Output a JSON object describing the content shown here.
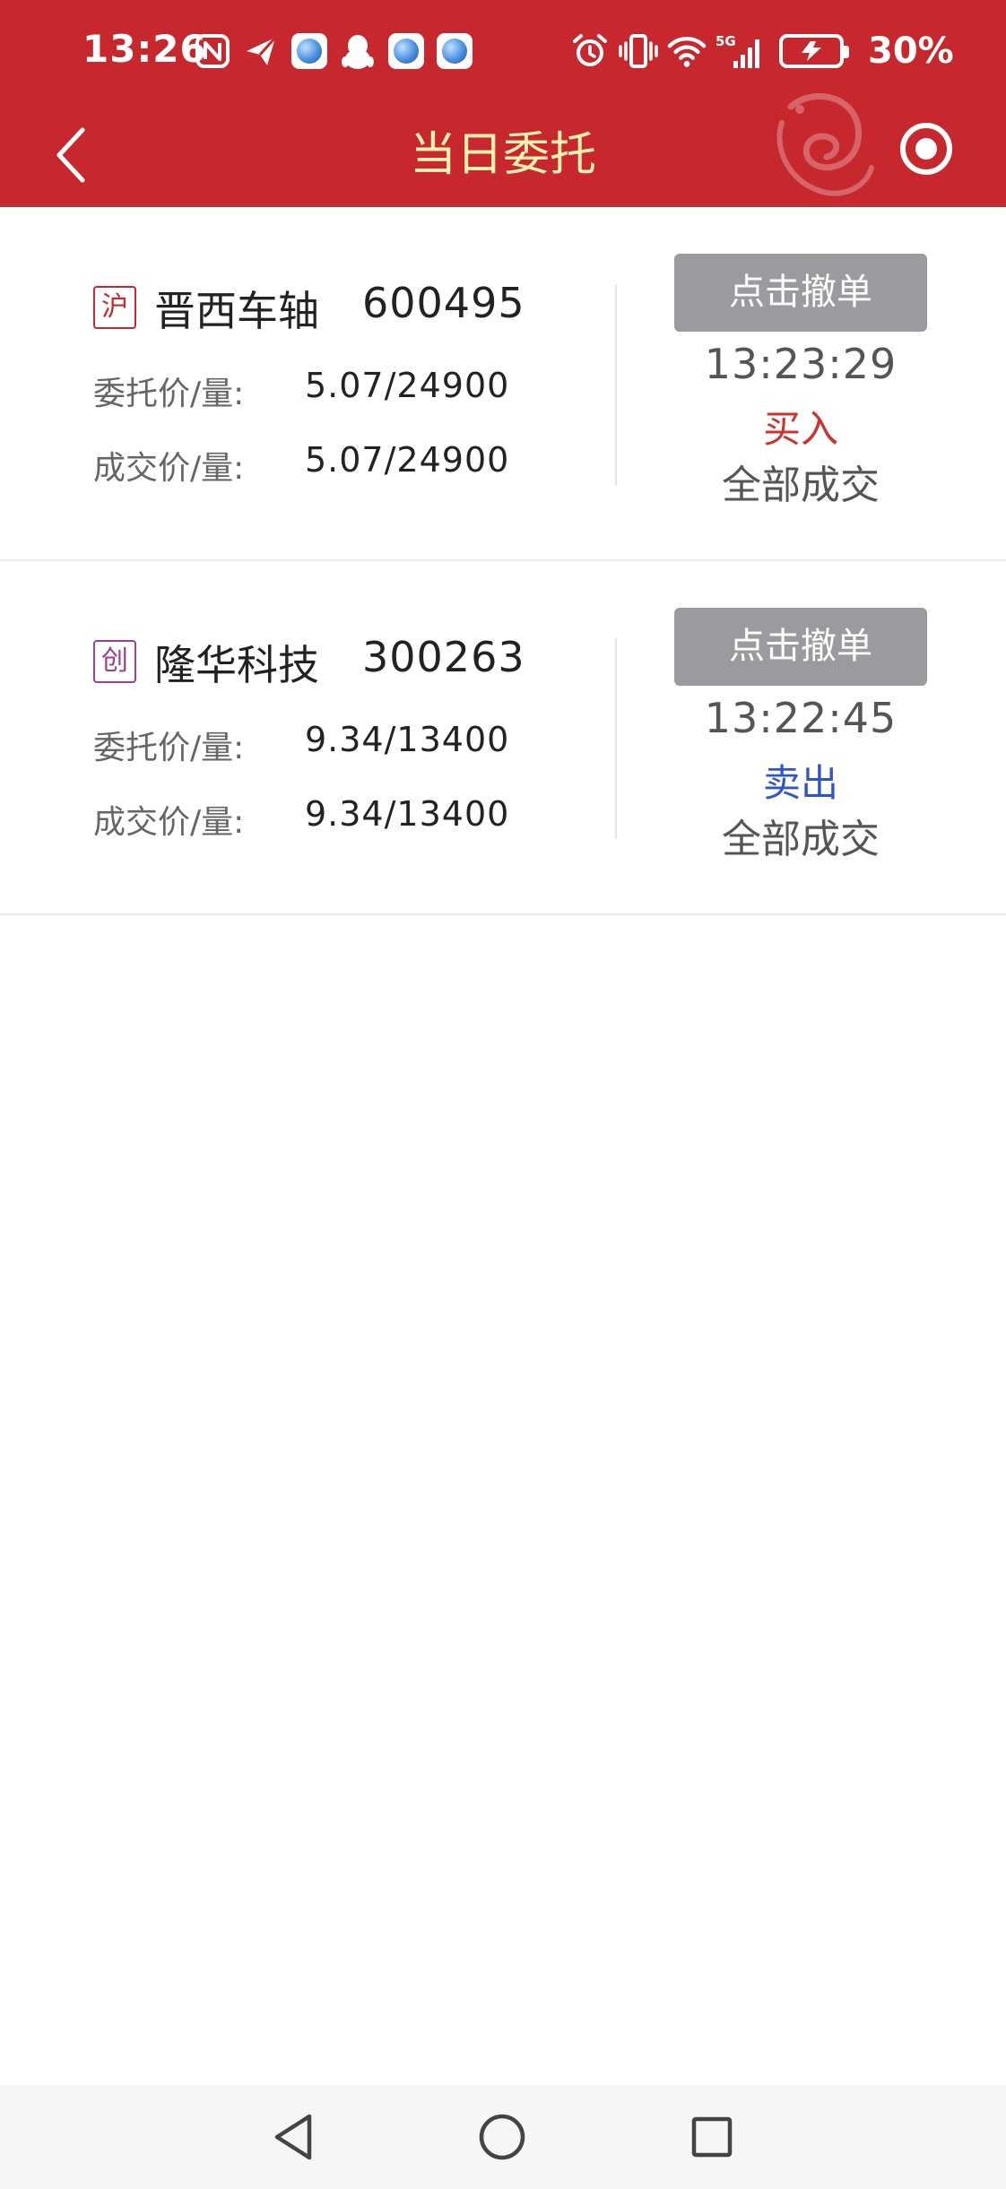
{
  "status_bar": {
    "time": "13:26",
    "battery_percent": "30%",
    "left_icons": [
      "nfc-icon",
      "send-app-icon",
      "browser-app-icon",
      "qq-penguin-icon",
      "browser-app-icon",
      "browser-app-icon"
    ],
    "right_icons": [
      "alarm-icon",
      "vibrate-icon",
      "wifi-icon",
      "5g-signal-icon",
      "battery-charging-icon"
    ],
    "network_label": "5G"
  },
  "header": {
    "title": "当日委托",
    "colors": {
      "background": "#c7282e",
      "title": "#fff2b0"
    }
  },
  "labels": {
    "entrust_price_qty": "委托价/量:",
    "deal_price_qty": "成交价/量:",
    "cancel_button": "点击撤单"
  },
  "orders": [
    {
      "market": "沪",
      "market_color": "#c7282e",
      "name": "晋西车轴",
      "code": "600495",
      "entrust": "5.07/24900",
      "deal": "5.07/24900",
      "time": "13:23:29",
      "side": "买入",
      "side_color": "#d0312d",
      "status": "全部成交"
    },
    {
      "market": "创",
      "market_color": "#9b3f8e",
      "name": "隆华科技",
      "code": "300263",
      "entrust": "9.34/13400",
      "deal": "9.34/13400",
      "time": "13:22:45",
      "side": "卖出",
      "side_color": "#2f55c8",
      "status": "全部成交"
    }
  ]
}
